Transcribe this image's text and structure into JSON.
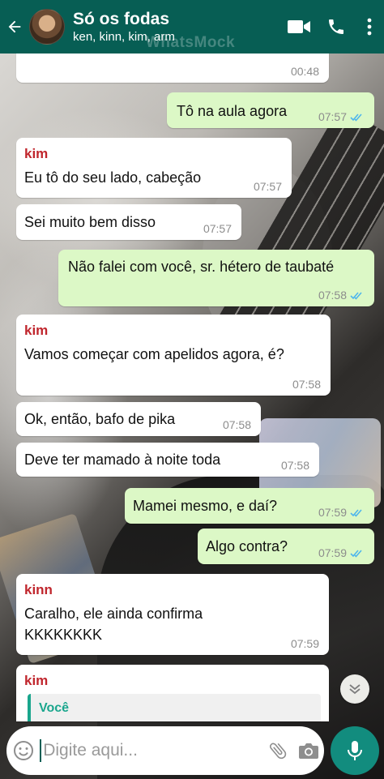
{
  "header": {
    "title": "Só os fodas",
    "subtitle": "ken, kinn, kim, arm",
    "watermark": "WhatsMock",
    "icons": [
      "back-arrow-icon",
      "video-call-icon",
      "phone-icon",
      "more-vert-icon"
    ],
    "color": "#075e54"
  },
  "messages": [
    {
      "direction": "in",
      "sender": "",
      "text": "",
      "time": "00:48"
    },
    {
      "direction": "out",
      "text": "Tô na aula agora",
      "time": "07:57",
      "status": "read"
    },
    {
      "direction": "in",
      "sender": "kim",
      "text": "Eu tô do seu lado, cabeção",
      "time": "07:57"
    },
    {
      "direction": "in",
      "sender": "",
      "text": "Sei muito bem disso",
      "time": "07:57"
    },
    {
      "direction": "out",
      "text": "Não falei com você, sr. hétero de taubaté",
      "time": "07:58",
      "status": "read"
    },
    {
      "direction": "in",
      "sender": "kim",
      "text": "Vamos começar com apelidos agora, é?",
      "time": "07:58"
    },
    {
      "direction": "in",
      "sender": "",
      "text": "Ok, então, bafo de pika",
      "time": "07:58"
    },
    {
      "direction": "in",
      "sender": "",
      "text": "Deve ter mamado à noite toda",
      "time": "07:58"
    },
    {
      "direction": "out",
      "text": "Mamei mesmo, e daí?",
      "time": "07:59",
      "status": "read"
    },
    {
      "direction": "out",
      "text": "Algo contra?",
      "time": "07:59",
      "status": "read"
    },
    {
      "direction": "in",
      "sender": "kinn",
      "text": "Caralho, ele ainda confirma KKKKKKKK",
      "time": "07:59"
    },
    {
      "direction": "in",
      "sender": "kim",
      "quote_author": "Você",
      "text": "",
      "time": ""
    }
  ],
  "input": {
    "placeholder": "Digite aqui...",
    "value": ""
  },
  "colors": {
    "incoming": "#ffffff",
    "outgoing": "#dcf8c6",
    "sender": "#c0262d",
    "read_ticks": "#4fb6ec",
    "mic": "#128c7e"
  }
}
